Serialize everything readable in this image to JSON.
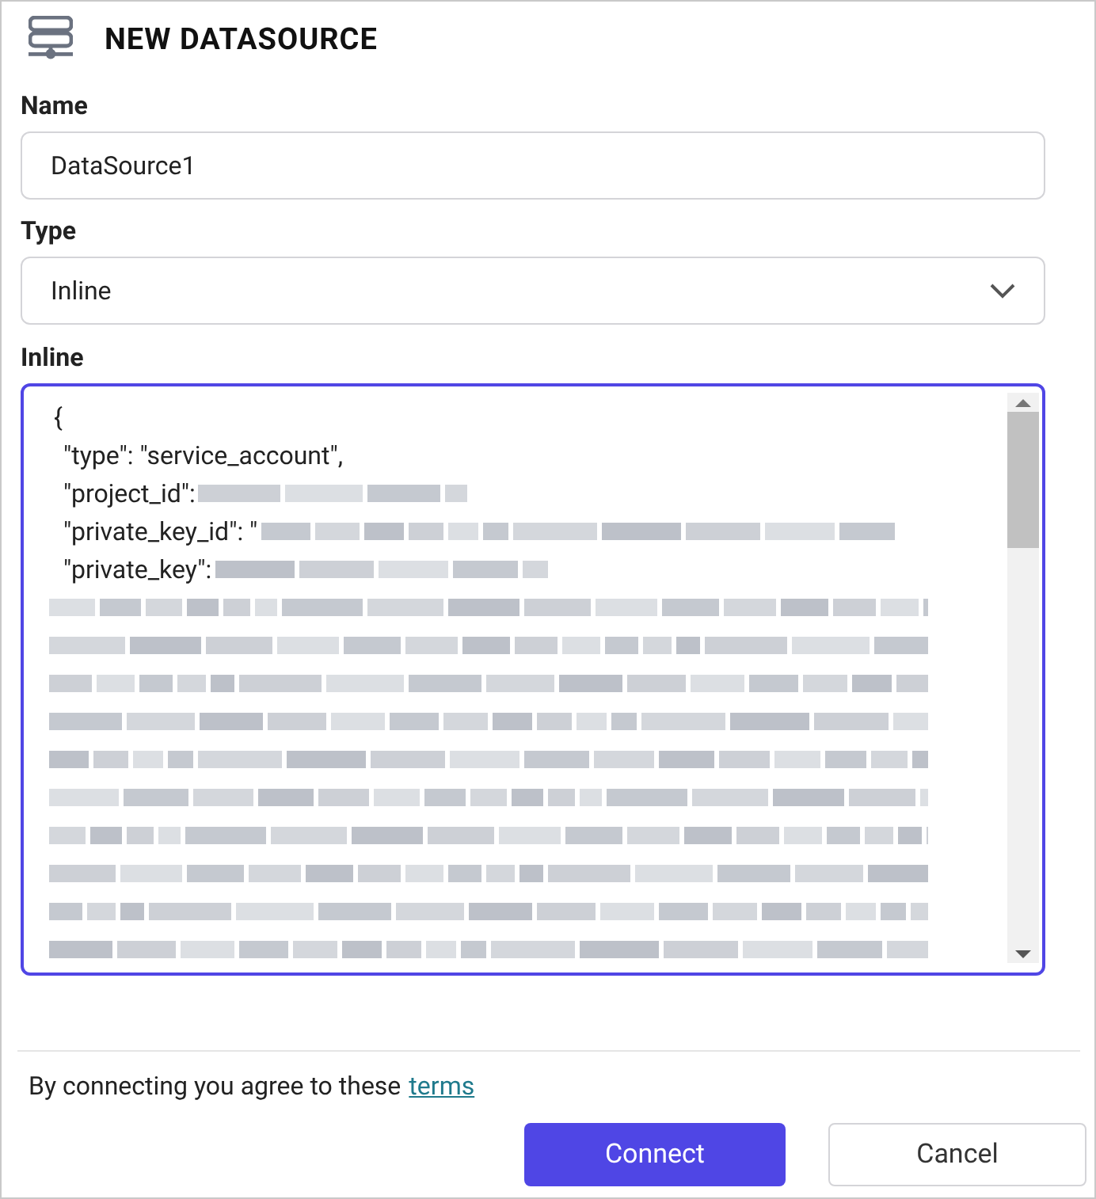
{
  "dialog": {
    "title": "NEW DATASOURCE"
  },
  "name_field": {
    "label": "Name",
    "value": "DataSource1"
  },
  "type_field": {
    "label": "Type",
    "value": "Inline"
  },
  "inline_field": {
    "label": "Inline",
    "lines": [
      {
        "kind": "text",
        "text": "{"
      },
      {
        "kind": "text",
        "text": "\"type\": \"service_account\","
      },
      {
        "kind": "text_redacted",
        "text": "\"project_id\":"
      },
      {
        "kind": "text_redacted",
        "text": "\"private_key_id\": \""
      },
      {
        "kind": "text_redacted",
        "text": "\"private_key\":"
      },
      {
        "kind": "redacted"
      },
      {
        "kind": "redacted"
      },
      {
        "kind": "redacted"
      },
      {
        "kind": "redacted"
      },
      {
        "kind": "redacted"
      },
      {
        "kind": "redacted"
      },
      {
        "kind": "redacted"
      },
      {
        "kind": "redacted"
      },
      {
        "kind": "redacted"
      },
      {
        "kind": "redacted"
      }
    ]
  },
  "footer": {
    "notice": "By connecting you agree to these",
    "link": "terms"
  },
  "buttons": [
    {
      "label": "Connect",
      "kind": "primary"
    },
    {
      "label": "Cancel",
      "kind": "secondary"
    }
  ]
}
